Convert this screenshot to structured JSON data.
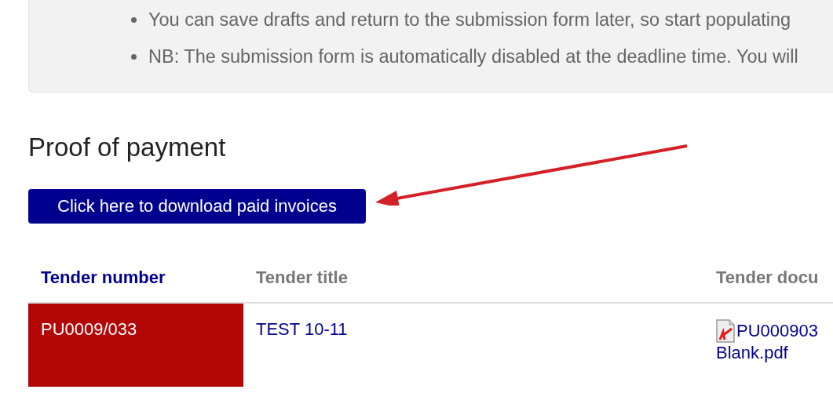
{
  "notice": {
    "items": [
      "You can save drafts and return to the submission form later, so start populating",
      "NB: The submission form is automatically disabled at the deadline time. You will"
    ]
  },
  "section": {
    "title": "Proof of payment",
    "button": "Click here to download paid invoices"
  },
  "table": {
    "columns": [
      {
        "label": "Tender number",
        "sorted": true
      },
      {
        "label": "Tender title",
        "sorted": false
      },
      {
        "label": "Tender docu",
        "sorted": false
      }
    ],
    "rows": [
      {
        "number": "PU0009/033",
        "color": "#b30606",
        "title": "TEST 10-11",
        "document": [
          "PU000903",
          "Blank.pdf"
        ]
      }
    ]
  }
}
